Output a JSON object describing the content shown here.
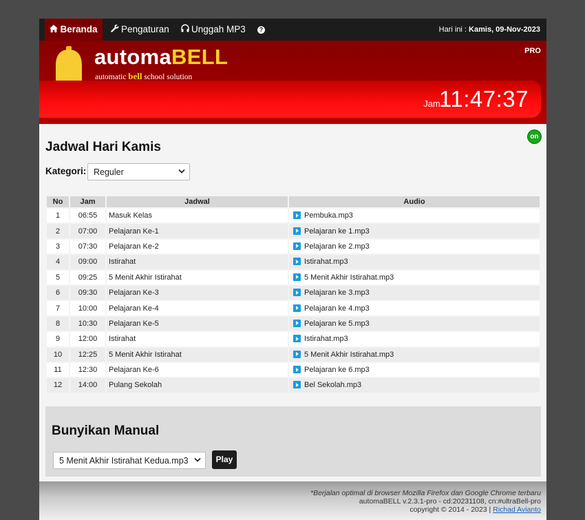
{
  "nav": {
    "items": [
      {
        "label": "Beranda",
        "icon": "home-icon"
      },
      {
        "label": "Pengaturan",
        "icon": "wrench-icon"
      },
      {
        "label": "Unggah MP3",
        "icon": "headphones-icon"
      },
      {
        "label": "",
        "icon": "help-icon"
      }
    ],
    "date_label": "Hari ini : ",
    "date_value": "Kamis, 09-Nov-2023"
  },
  "header": {
    "brand_part1": "automa",
    "brand_part2": "BELL",
    "tagline_pre": "automatic ",
    "tagline_bold": "bell",
    "tagline_post": " school solution",
    "edition": "PRO",
    "clock_label": "Jam :",
    "clock_time": "11:47:37"
  },
  "status": "on",
  "schedule": {
    "title": "Jadwal Hari Kamis",
    "category_label": "Kategori:",
    "category_value": "Reguler",
    "columns": [
      "No",
      "Jam",
      "Jadwal",
      "Audio"
    ],
    "rows": [
      {
        "no": "1",
        "jam": "06:55",
        "jadwal": "Masuk Kelas",
        "audio": "Pembuka.mp3"
      },
      {
        "no": "2",
        "jam": "07:00",
        "jadwal": "Pelajaran Ke-1",
        "audio": "Pelajaran ke 1.mp3"
      },
      {
        "no": "3",
        "jam": "07:30",
        "jadwal": "Pelajaran Ke-2",
        "audio": "Pelajaran ke 2.mp3"
      },
      {
        "no": "4",
        "jam": "09:00",
        "jadwal": "Istirahat",
        "audio": "Istirahat.mp3"
      },
      {
        "no": "5",
        "jam": "09:25",
        "jadwal": "5 Menit Akhir Istirahat",
        "audio": "5 Menit Akhir Istirahat.mp3"
      },
      {
        "no": "6",
        "jam": "09:30",
        "jadwal": "Pelajaran Ke-3",
        "audio": "Pelajaran ke 3.mp3"
      },
      {
        "no": "7",
        "jam": "10:00",
        "jadwal": "Pelajaran Ke-4",
        "audio": "Pelajaran ke 4.mp3"
      },
      {
        "no": "8",
        "jam": "10:30",
        "jadwal": "Pelajaran Ke-5",
        "audio": "Pelajaran ke 5.mp3"
      },
      {
        "no": "9",
        "jam": "12:00",
        "jadwal": "Istirahat",
        "audio": "Istirahat.mp3"
      },
      {
        "no": "10",
        "jam": "12:25",
        "jadwal": "5 Menit Akhir Istirahat",
        "audio": "5 Menit Akhir Istirahat.mp3"
      },
      {
        "no": "11",
        "jam": "12:30",
        "jadwal": "Pelajaran Ke-6",
        "audio": "Pelajaran ke 6.mp3"
      },
      {
        "no": "12",
        "jam": "14:00",
        "jadwal": "Pulang Sekolah",
        "audio": "Bel Sekolah.mp3"
      }
    ]
  },
  "manual": {
    "title": "Bunyikan Manual",
    "selected_file": "5 Menit Akhir Istirahat Kedua.mp3",
    "play_label": "Play"
  },
  "footer": {
    "note": "*Berjalan optimal di browser Mozilla Firefox dan Google Chrome terbaru",
    "version": "automaBELL v.2.3.1-pro - cd:20231108, cn:#ultraBell-pro",
    "copyright": "copyright © 2014 - 2023 | ",
    "author": "Richad Avianto"
  },
  "colors": {
    "nav_bg": "#1c1c1c",
    "active_tab": "#7a0000",
    "header_red": "#9a0000",
    "brand_yellow": "#ffd21f",
    "status_green": "#18a71a",
    "play_blue": "#1a9be0"
  }
}
